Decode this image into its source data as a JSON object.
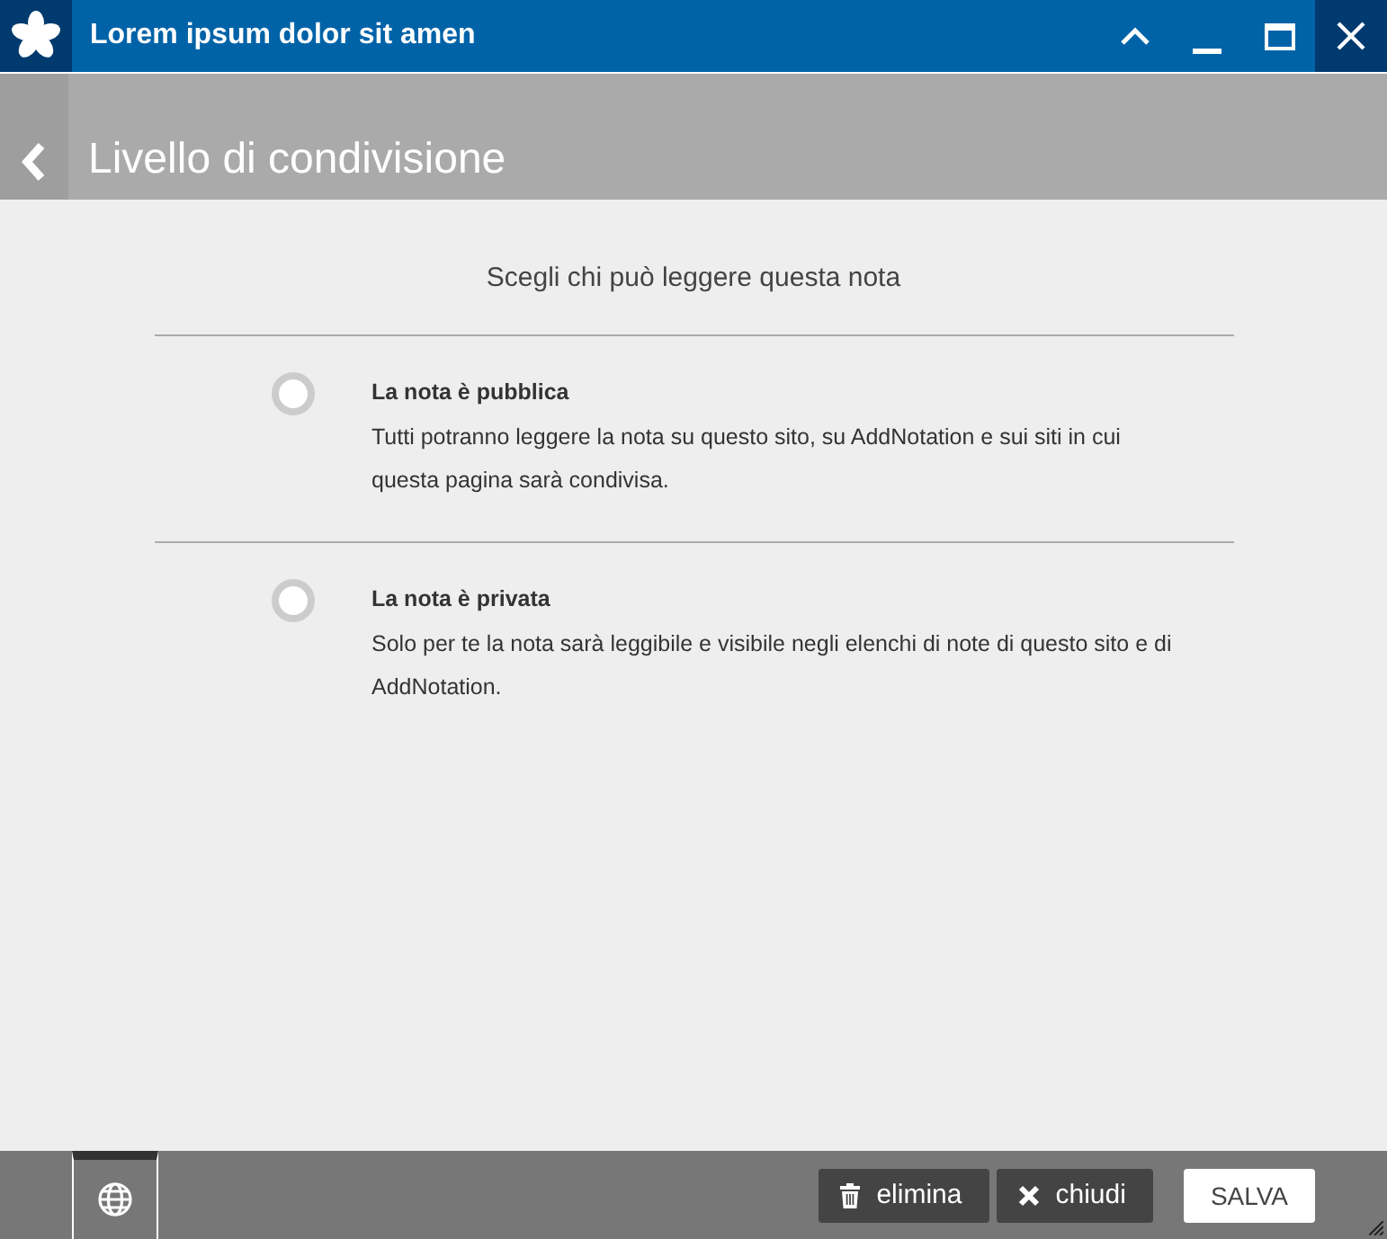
{
  "window": {
    "title": "Lorem ipsum dolor sit amen"
  },
  "header": {
    "title": "Livello di condivisione"
  },
  "prompt": "Scegli chi può leggere questa nota",
  "options": [
    {
      "title": "La nota è pubblica",
      "description": "Tutti potranno leggere la nota su questo sito, su AddNotation e sui siti in cui questa pagina sarà condivisa.",
      "selected": false
    },
    {
      "title": "La nota è privata",
      "description": "Solo per te la nota sarà leggibile e visibile negli elenchi di note di questo sito e di AddNotation.",
      "selected": false
    }
  ],
  "footer": {
    "buttons": [
      {
        "kind": "delete",
        "label": "elimina"
      },
      {
        "kind": "close",
        "label": "chiudi"
      },
      {
        "kind": "save",
        "label": "SALVA"
      }
    ]
  }
}
